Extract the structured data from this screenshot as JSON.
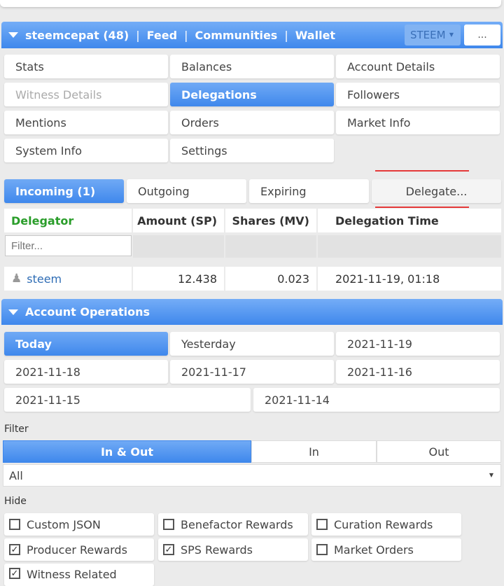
{
  "header": {
    "user": "steemcepat (48)",
    "links": [
      "Feed",
      "Communities",
      "Wallet"
    ],
    "currency": "STEEM",
    "more_label": "..."
  },
  "nav": [
    {
      "label": "Stats",
      "state": "normal"
    },
    {
      "label": "Balances",
      "state": "normal"
    },
    {
      "label": "Account Details",
      "state": "normal"
    },
    {
      "label": "Witness Details",
      "state": "disabled"
    },
    {
      "label": "Delegations",
      "state": "active"
    },
    {
      "label": "Followers",
      "state": "normal"
    },
    {
      "label": "Mentions",
      "state": "normal"
    },
    {
      "label": "Orders",
      "state": "normal"
    },
    {
      "label": "Market Info",
      "state": "normal"
    },
    {
      "label": "System Info",
      "state": "normal"
    },
    {
      "label": "Settings",
      "state": "normal"
    }
  ],
  "delegation_tabs": [
    "Incoming (1)",
    "Outgoing",
    "Expiring",
    "Delegate..."
  ],
  "table": {
    "headers": [
      "Delegator",
      "Amount (SP)",
      "Shares (MV)",
      "Delegation Time"
    ],
    "filter_placeholder": "Filter...",
    "rows": [
      {
        "delegator": "steem",
        "amount": "12.438",
        "shares": "0.023",
        "time": "2021-11-19, 01:18"
      }
    ]
  },
  "ops": {
    "title": "Account Operations",
    "dates": [
      "Today",
      "Yesterday",
      "2021-11-19",
      "2021-11-18",
      "2021-11-17",
      "2021-11-16",
      "2021-11-15",
      "2021-11-14"
    ],
    "filter_label": "Filter",
    "direction": [
      "In & Out",
      "In",
      "Out"
    ],
    "select_value": "All",
    "hide_label": "Hide",
    "hide_options": [
      {
        "label": "Custom JSON",
        "checked": false
      },
      {
        "label": "Benefactor Rewards",
        "checked": false
      },
      {
        "label": "Curation Rewards",
        "checked": false
      },
      {
        "label": "Producer Rewards",
        "checked": true
      },
      {
        "label": "SPS Rewards",
        "checked": true
      },
      {
        "label": "Market Orders",
        "checked": false
      },
      {
        "label": "Witness Related",
        "checked": true
      }
    ]
  },
  "colors": {
    "accent": "#4a90ee",
    "delegator_header": "#2a9d2a",
    "link": "#2f6db5",
    "underline": "#e53939"
  }
}
